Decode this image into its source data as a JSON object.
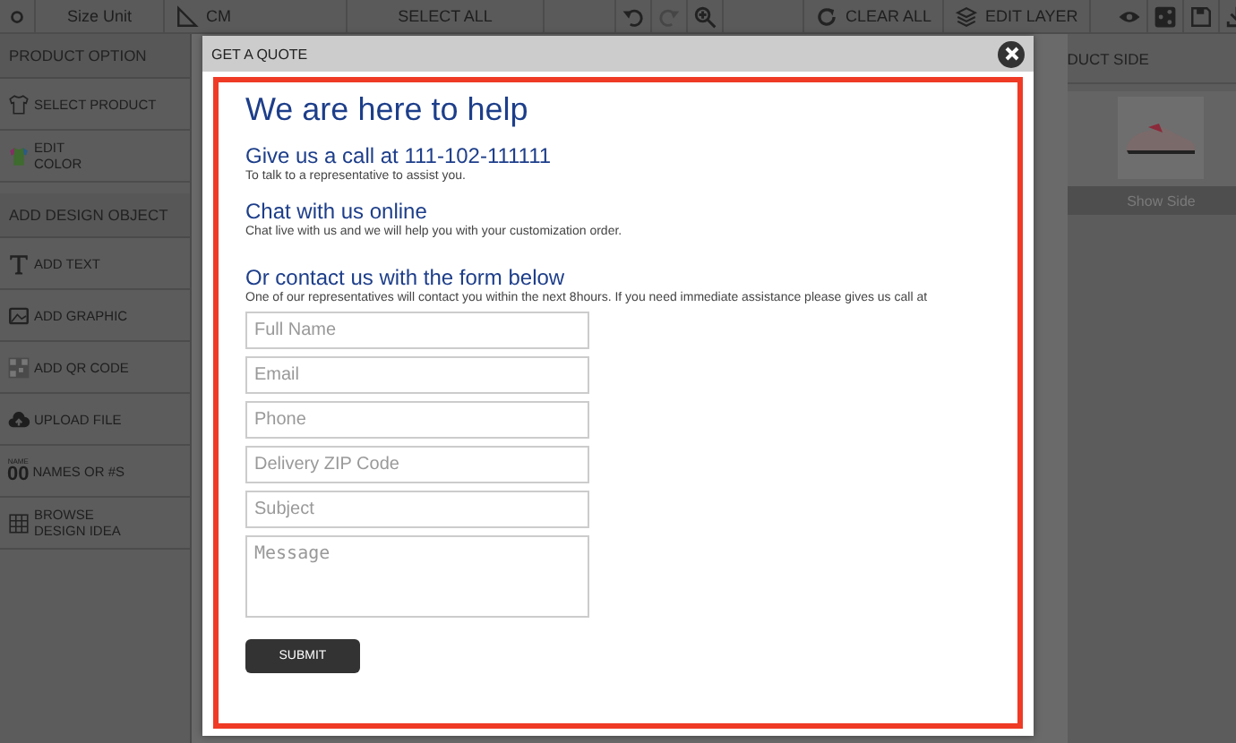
{
  "toolbar": {
    "items": [
      {
        "kind": "text",
        "label": "Size Unit"
      },
      {
        "kind": "ruler",
        "label": "CM"
      },
      {
        "kind": "text",
        "label": "SELECT ALL"
      },
      {
        "kind": "refresh",
        "label": "CLEAR ALL"
      },
      {
        "kind": "layers",
        "label": "EDIT LAYER"
      }
    ],
    "redo_disabled": true
  },
  "sidebar": {
    "sections": [
      {
        "title": "PRODUCT OPTION",
        "items": [
          {
            "kind": "shirt",
            "label": "SELECT PRODUCT"
          },
          {
            "kind": "palette",
            "label": "EDIT\nCOLOR"
          }
        ]
      },
      {
        "title": "ADD DESIGN OBJECT",
        "items": [
          {
            "kind": "text",
            "label": "ADD TEXT"
          },
          {
            "kind": "graphic",
            "label": "ADD GRAPHIC"
          },
          {
            "kind": "qr",
            "label": "ADD QR CODE"
          },
          {
            "kind": "upload",
            "label": "UPLOAD FILE"
          },
          {
            "kind": "number",
            "label": "NAMES OR #S",
            "badge_top": "NAME",
            "badge": "00"
          },
          {
            "kind": "grid",
            "label": "BROWSE\nDESIGN IDEA"
          }
        ]
      }
    ]
  },
  "product_side": {
    "title": "DUCT SIDE",
    "caption": "Show Side"
  },
  "modal": {
    "title": "GET A QUOTE",
    "heading": "We are here to help",
    "sections": [
      {
        "title": "Give us a call at 111-102-111111",
        "text": "To talk to a representative to assist you."
      },
      {
        "title": "Chat with us online",
        "text": "Chat live with us and we will help you with your customization order."
      },
      {
        "title": "Or contact us with the form below",
        "text": "One of our representatives will contact you within the next 8hours.  If you need immediate assistance please gives us call at"
      }
    ],
    "fields": [
      {
        "placeholder": "Full Name"
      },
      {
        "placeholder": "Email"
      },
      {
        "placeholder": "Phone"
      },
      {
        "placeholder": "Delivery ZIP Code"
      },
      {
        "placeholder": "Subject"
      }
    ],
    "message": {
      "placeholder": "Message"
    },
    "submit": "SUBMIT"
  }
}
